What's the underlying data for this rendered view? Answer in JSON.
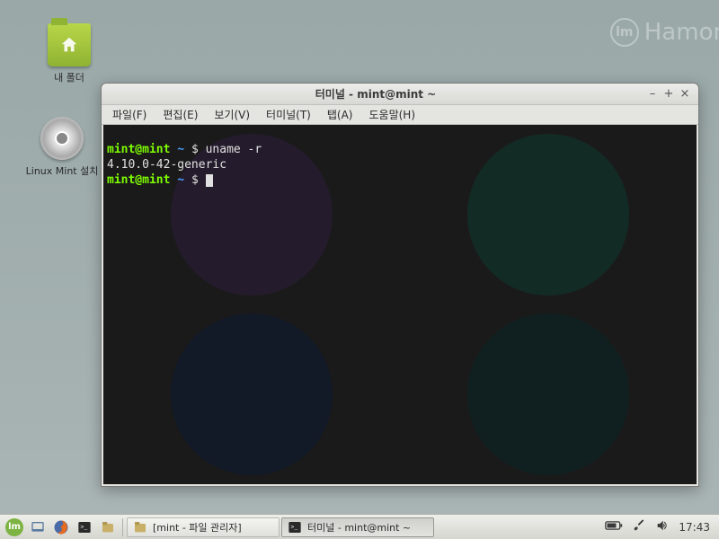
{
  "watermark": {
    "text": "Hamon",
    "logo_glyph": "lm"
  },
  "desktop": {
    "icons": [
      {
        "label": "내 폴더"
      },
      {
        "label": "Linux Mint 설치"
      }
    ]
  },
  "terminal": {
    "title": "터미널 - mint@mint ~",
    "menu": [
      "파일(F)",
      "편집(E)",
      "보기(V)",
      "터미널(T)",
      "탭(A)",
      "도움말(H)"
    ],
    "prompt": {
      "user_host": "mint@mint",
      "cwd": "~",
      "symbol": "$"
    },
    "lines": [
      {
        "type": "cmd",
        "text": "uname -r"
      },
      {
        "type": "out",
        "text": "4.10.0-42-generic"
      },
      {
        "type": "prompt",
        "text": ""
      }
    ]
  },
  "window_controls": {
    "minimize": "–",
    "maximize": "+",
    "close": "×"
  },
  "taskbar": {
    "items": [
      {
        "label": "[mint - 파일 관리자]",
        "active": false
      },
      {
        "label": "터미널 - mint@mint ~",
        "active": true
      }
    ],
    "clock": "17:43"
  }
}
